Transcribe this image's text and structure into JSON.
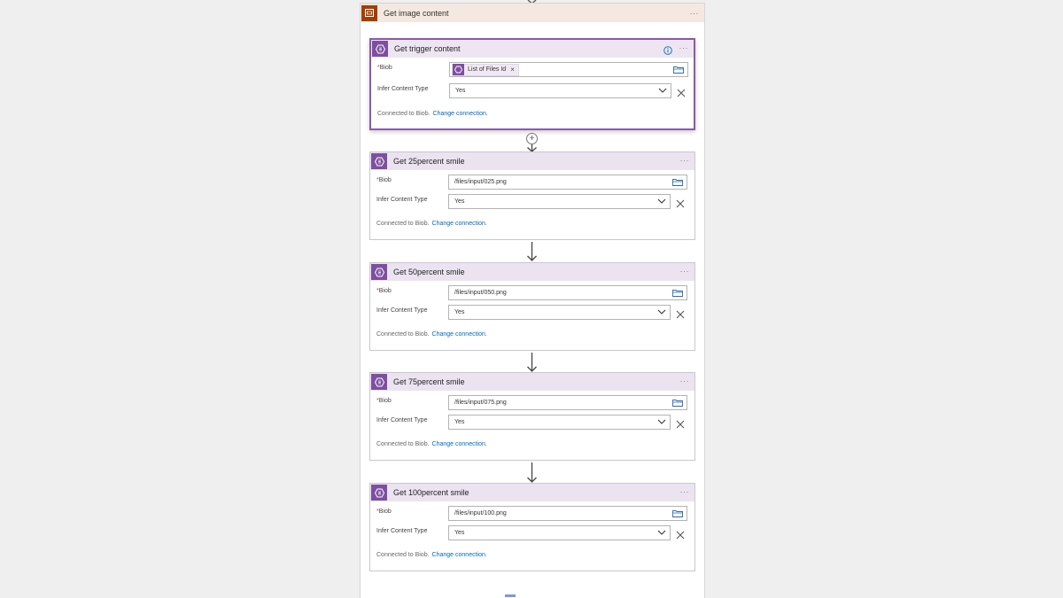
{
  "scope": {
    "title": "Get image content",
    "menu": "···"
  },
  "cards": [
    {
      "title": "Get trigger content",
      "menu": "···",
      "blob_label": "Biob",
      "blob_token": "List of Files Id",
      "type_label": "Infer Content Type",
      "type_value": "Yes",
      "conn_text": "Connected to Biob.",
      "conn_link": "Change connection."
    },
    {
      "title": "Get 25percent smile",
      "menu": "···",
      "blob_label": "Biob",
      "blob_value": "/files/input/025.png",
      "type_label": "Infer Content Type",
      "type_value": "Yes",
      "conn_text": "Connected to Biob.",
      "conn_link": "Change connection."
    },
    {
      "title": "Get 50percent smile",
      "menu": "···",
      "blob_label": "Biob",
      "blob_value": "/files/input/050.png",
      "type_label": "Infer Content Type",
      "type_value": "Yes",
      "conn_text": "Connected to Biob.",
      "conn_link": "Change connection."
    },
    {
      "title": "Get 75percent smile",
      "menu": "···",
      "blob_label": "Biob",
      "blob_value": "/files/input/075.png",
      "type_label": "Infer Content Type",
      "type_value": "Yes",
      "conn_text": "Connected to Biob.",
      "conn_link": "Change connection."
    },
    {
      "title": "Get 100percent smile",
      "menu": "···",
      "blob_label": "Biob",
      "blob_value": "/files/input/100.png",
      "type_label": "Infer Content Type",
      "type_value": "Yes",
      "conn_text": "Connected to Biob.",
      "conn_link": "Change connection."
    }
  ],
  "colors": {
    "scope_icon": "#a33e00",
    "card_icon": "#7d4fa0",
    "link": "#0067b8",
    "required": "#c4314b"
  },
  "icons": {
    "scope": "scope-icon",
    "card": "blob-icon",
    "info": "info-icon",
    "folder": "folder-icon",
    "chevron": "chevron-down-icon",
    "clear": "close-icon",
    "add": "plus-icon",
    "arrow": "arrow-down-icon"
  }
}
